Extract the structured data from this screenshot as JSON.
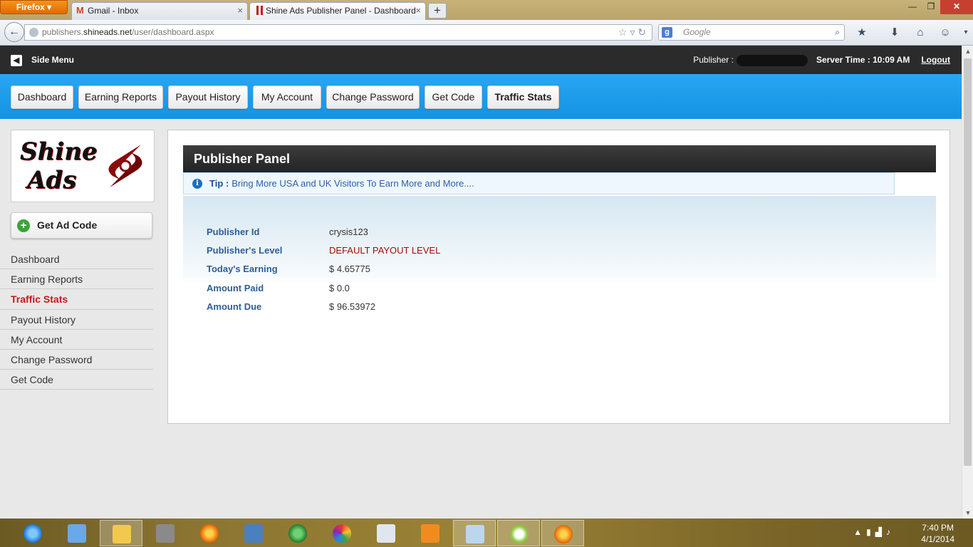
{
  "browser": {
    "app_button": "Firefox",
    "tabs": [
      {
        "label": "Gmail - Inbox",
        "active": false
      },
      {
        "label": "Shine Ads Publisher Panel - Dashboard",
        "active": true
      }
    ],
    "url_prefix": "publishers.",
    "url_domain": "shineads.net",
    "url_path": "/user/dashboard.aspx",
    "search_placeholder": "Google",
    "new_tab_symbol": "+"
  },
  "topbar": {
    "side_menu_label": "Side Menu",
    "publisher_label": "Publisher :",
    "server_time": "Server Time : 10:09 AM",
    "logout_label": "Logout"
  },
  "nav_buttons": [
    "Dashboard",
    "Earning Reports",
    "Payout History",
    "My Account",
    "Change Password",
    "Get Code",
    "Traffic Stats"
  ],
  "logo": {
    "line1": "Shine",
    "line2": "Ads"
  },
  "get_ad_code_label": "Get Ad Code",
  "sidebar": {
    "items": [
      "Dashboard",
      "Earning Reports",
      "Traffic Stats",
      "Payout History",
      "My Account",
      "Change Password",
      "Get Code"
    ],
    "active_index": 2
  },
  "panel": {
    "title": "Publisher Panel",
    "tip_label": "Tip :",
    "tip_text": "Bring More USA and UK Visitors To Earn More and More....",
    "fields": [
      {
        "label": "Publisher Id",
        "value": "crysis123"
      },
      {
        "label": "Publisher's Level",
        "value": "DEFAULT PAYOUT LEVEL"
      },
      {
        "label": "Today's Earning",
        "value": "$ 4.65775"
      },
      {
        "label": "Amount Paid",
        "value": "$ 0.0"
      },
      {
        "label": "Amount Due",
        "value": "$ 96.53972"
      }
    ]
  },
  "taskbar": {
    "time": "7:40 PM",
    "date": "4/1/2014",
    "apps": [
      "internet-explorer-icon",
      "control-panel-icon",
      "file-explorer-icon",
      "app-grid-icon",
      "firefox-icon",
      "remote-desktop-icon",
      "download-manager-icon",
      "picasa-icon",
      "task-manager-icon",
      "media-player-icon",
      "notepad-icon",
      "orange-app-icon",
      "firefox-active-icon"
    ]
  },
  "colors": {
    "accent_blue": "#1a9be8",
    "topbar_dark": "#2b2b2b",
    "active_red": "#c8151b",
    "label_blue": "#2e5d99"
  }
}
